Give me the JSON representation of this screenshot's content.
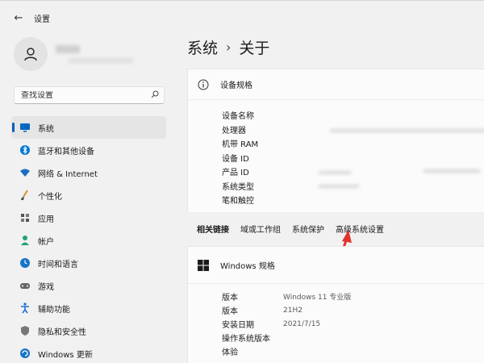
{
  "titlebar": {
    "back_label": "←",
    "title": "设置"
  },
  "search": {
    "placeholder": "查找设置"
  },
  "sidebar": {
    "items": [
      {
        "label": "系统",
        "icon": "monitor-icon",
        "color": "#0067c0"
      },
      {
        "label": "蓝牙和其他设备",
        "icon": "bluetooth-icon",
        "color": "#0078d4"
      },
      {
        "label": "网络 & Internet",
        "icon": "wifi-icon",
        "color": "#1a6fc2"
      },
      {
        "label": "个性化",
        "icon": "brush-icon",
        "color": "#d68e30"
      },
      {
        "label": "应用",
        "icon": "apps-icon",
        "color": "#555555"
      },
      {
        "label": "帐户",
        "icon": "account-icon",
        "color": "#1ea176"
      },
      {
        "label": "时间和语言",
        "icon": "clock-globe-icon",
        "color": "#1673c7"
      },
      {
        "label": "游戏",
        "icon": "gamepad-icon",
        "color": "#666666"
      },
      {
        "label": "辅助功能",
        "icon": "accessibility-icon",
        "color": "#1a6fd0"
      },
      {
        "label": "隐私和安全性",
        "icon": "shield-icon",
        "color": "#777777"
      },
      {
        "label": "Windows 更新",
        "icon": "update-icon",
        "color": "#1673c7"
      }
    ]
  },
  "main": {
    "breadcrumb": {
      "parent": "系统",
      "separator": "›",
      "current": "关于"
    },
    "device_specs": {
      "title": "设备规格",
      "rows": [
        {
          "label": "设备名称"
        },
        {
          "label": "处理器",
          "value": "H"
        },
        {
          "label": "机带 RAM"
        },
        {
          "label": "设备 ID"
        },
        {
          "label": "产品 ID"
        },
        {
          "label": "系统类型"
        },
        {
          "label": "笔和触控"
        }
      ]
    },
    "related_links": {
      "title": "相关链接",
      "links": [
        "域或工作组",
        "系统保护",
        "高级系统设置"
      ]
    },
    "windows_specs": {
      "title": "Windows 规格",
      "rows": [
        {
          "label": "版本",
          "value": "Windows 11 专业版"
        },
        {
          "label": "版本",
          "value": "21H2"
        },
        {
          "label": "安装日期",
          "value": "2021/7/15"
        },
        {
          "label": "操作系统版本",
          "value": ""
        },
        {
          "label": "体验",
          "value": ""
        }
      ]
    }
  },
  "colors": {
    "accent": "#005fb8",
    "annotation_arrow": "#e0332f"
  }
}
